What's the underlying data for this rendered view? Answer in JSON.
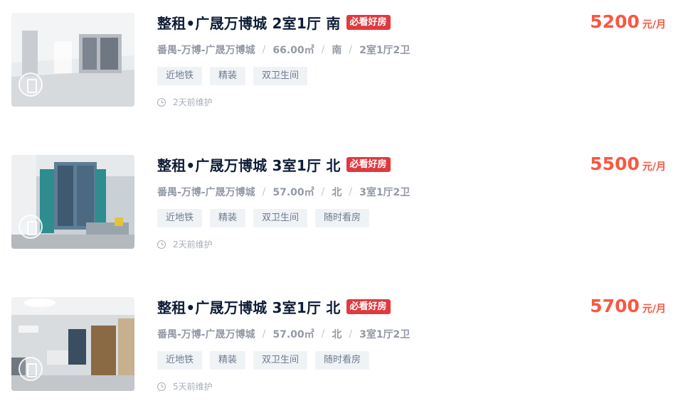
{
  "listings": [
    {
      "title": "整租•广晟万博城 2室1厅 南",
      "badge": "必看好房",
      "district": "番禺-万博-广晟万博城",
      "area": "66.00㎡",
      "orientation": "南",
      "layout": "2室1厅2卫",
      "tags": [
        "近地铁",
        "精装",
        "双卫生间"
      ],
      "updated": "2天前维护",
      "price": "5200",
      "price_unit": "元/月",
      "photo_icon": "room-photo"
    },
    {
      "title": "整租•广晟万博城 3室1厅 北",
      "badge": "必看好房",
      "district": "番禺-万博-广晟万博城",
      "area": "57.00㎡",
      "orientation": "北",
      "layout": "3室1厅2卫",
      "tags": [
        "近地铁",
        "精装",
        "双卫生间",
        "随时看房"
      ],
      "updated": "2天前维护",
      "price": "5500",
      "price_unit": "元/月",
      "photo_icon": "room-photo"
    },
    {
      "title": "整租•广晟万博城 3室1厅 北",
      "badge": "必看好房",
      "district": "番禺-万博-广晟万博城",
      "area": "57.00㎡",
      "orientation": "北",
      "layout": "3室1厅2卫",
      "tags": [
        "近地铁",
        "精装",
        "双卫生间",
        "随时看房"
      ],
      "updated": "5天前维护",
      "price": "5700",
      "price_unit": "元/月",
      "photo_icon": "room-photo"
    }
  ],
  "colors": {
    "price": "#fa5741",
    "badge": "#e0393e",
    "title": "#101d37",
    "tag_bg": "#f0f3f6"
  }
}
